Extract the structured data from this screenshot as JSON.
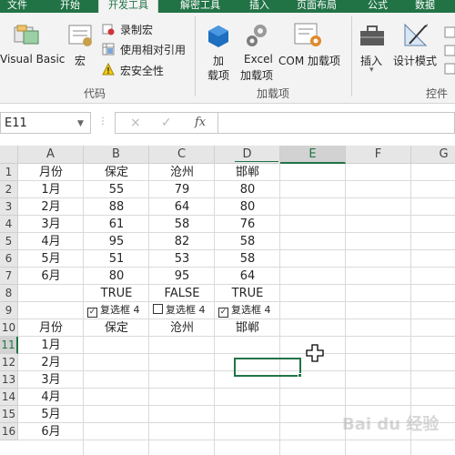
{
  "tabs": {
    "file": "文件",
    "home": "开始",
    "developer": "开发工具",
    "unlock": "解密工具",
    "insert": "插入",
    "page_layout": "页面布局",
    "formulas": "公式",
    "data": "数据"
  },
  "ribbon": {
    "code_group": {
      "visual_basic": "Visual Basic",
      "macros": "宏",
      "record_macro": "录制宏",
      "relative_ref": "使用相对引用",
      "macro_security": "宏安全性",
      "label": "代码"
    },
    "addins_group": {
      "addins_line1": "加",
      "addins_line2": "载项",
      "excel_addins_line1": "Excel",
      "excel_addins_line2": "加载项",
      "com_addins": "COM 加载项",
      "label": "加载项"
    },
    "controls_group": {
      "insert": "插入",
      "design_mode": "设计模式",
      "label": "控件"
    }
  },
  "formula_bar": {
    "name_box": "E11",
    "fx": "fx",
    "cancel": "×",
    "enter": "✓",
    "value": ""
  },
  "sheet": {
    "columns": [
      "A",
      "B",
      "C",
      "D",
      "E",
      "F",
      "G"
    ],
    "selected_column": "E",
    "rows": [
      "1",
      "2",
      "3",
      "4",
      "5",
      "6",
      "7",
      "8",
      "9",
      "10",
      "11",
      "12",
      "13",
      "14",
      "15",
      "16"
    ],
    "selected_row": "11",
    "cells": {
      "A1": "月份",
      "B1": "保定",
      "C1": "沧州",
      "D1": "邯郸",
      "A2": "1月",
      "B2": "55",
      "C2": "79",
      "D2": "80",
      "A3": "2月",
      "B3": "88",
      "C3": "64",
      "D3": "80",
      "A4": "3月",
      "B4": "61",
      "C4": "58",
      "D4": "76",
      "A5": "4月",
      "B5": "95",
      "C5": "82",
      "D5": "58",
      "A6": "5月",
      "B6": "51",
      "C6": "53",
      "D6": "58",
      "A7": "6月",
      "B7": "80",
      "C7": "95",
      "D7": "64",
      "B8": "TRUE",
      "C8": "FALSE",
      "D8": "TRUE",
      "A10": "月份",
      "B10": "保定",
      "C10": "沧州",
      "D10": "邯郸",
      "A11": "1月",
      "A12": "2月",
      "A13": "3月",
      "A14": "4月",
      "A15": "5月",
      "A16": "6月"
    },
    "checkboxes": [
      {
        "label": "复选框 4",
        "checked": true,
        "mark": "✓"
      },
      {
        "label": "复选框 4",
        "checked": false,
        "mark": ""
      },
      {
        "label": "复选框 4",
        "checked": true,
        "mark": "✓"
      }
    ]
  },
  "watermark": "Bai du 经验",
  "colors": {
    "accent": "#217346"
  }
}
